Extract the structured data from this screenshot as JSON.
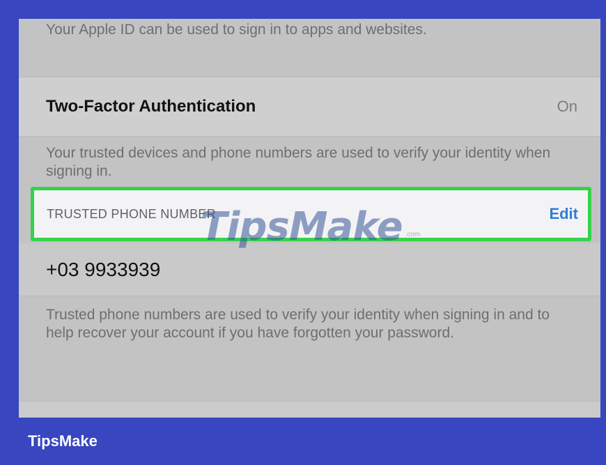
{
  "apple_id_note": "Your Apple ID can be used to sign in to apps and websites.",
  "two_factor": {
    "label": "Two-Factor Authentication",
    "status": "On"
  },
  "two_factor_note": "Your trusted devices and phone numbers are used to verify your identity when signing in.",
  "trusted_phone": {
    "header": "TRUSTED PHONE NUMBER",
    "edit_label": "Edit",
    "number": "+03 9933939"
  },
  "trusted_phone_note": "Trusted phone numbers are used to verify your identity when signing in and to help recover your account if you have forgotten your password.",
  "watermark": {
    "text": "TipsMake",
    "suffix": ".com"
  },
  "brand": "TipsMake",
  "colors": {
    "frame": "#3846bf",
    "highlight": "#34d34a",
    "link": "#2f7fd1"
  }
}
